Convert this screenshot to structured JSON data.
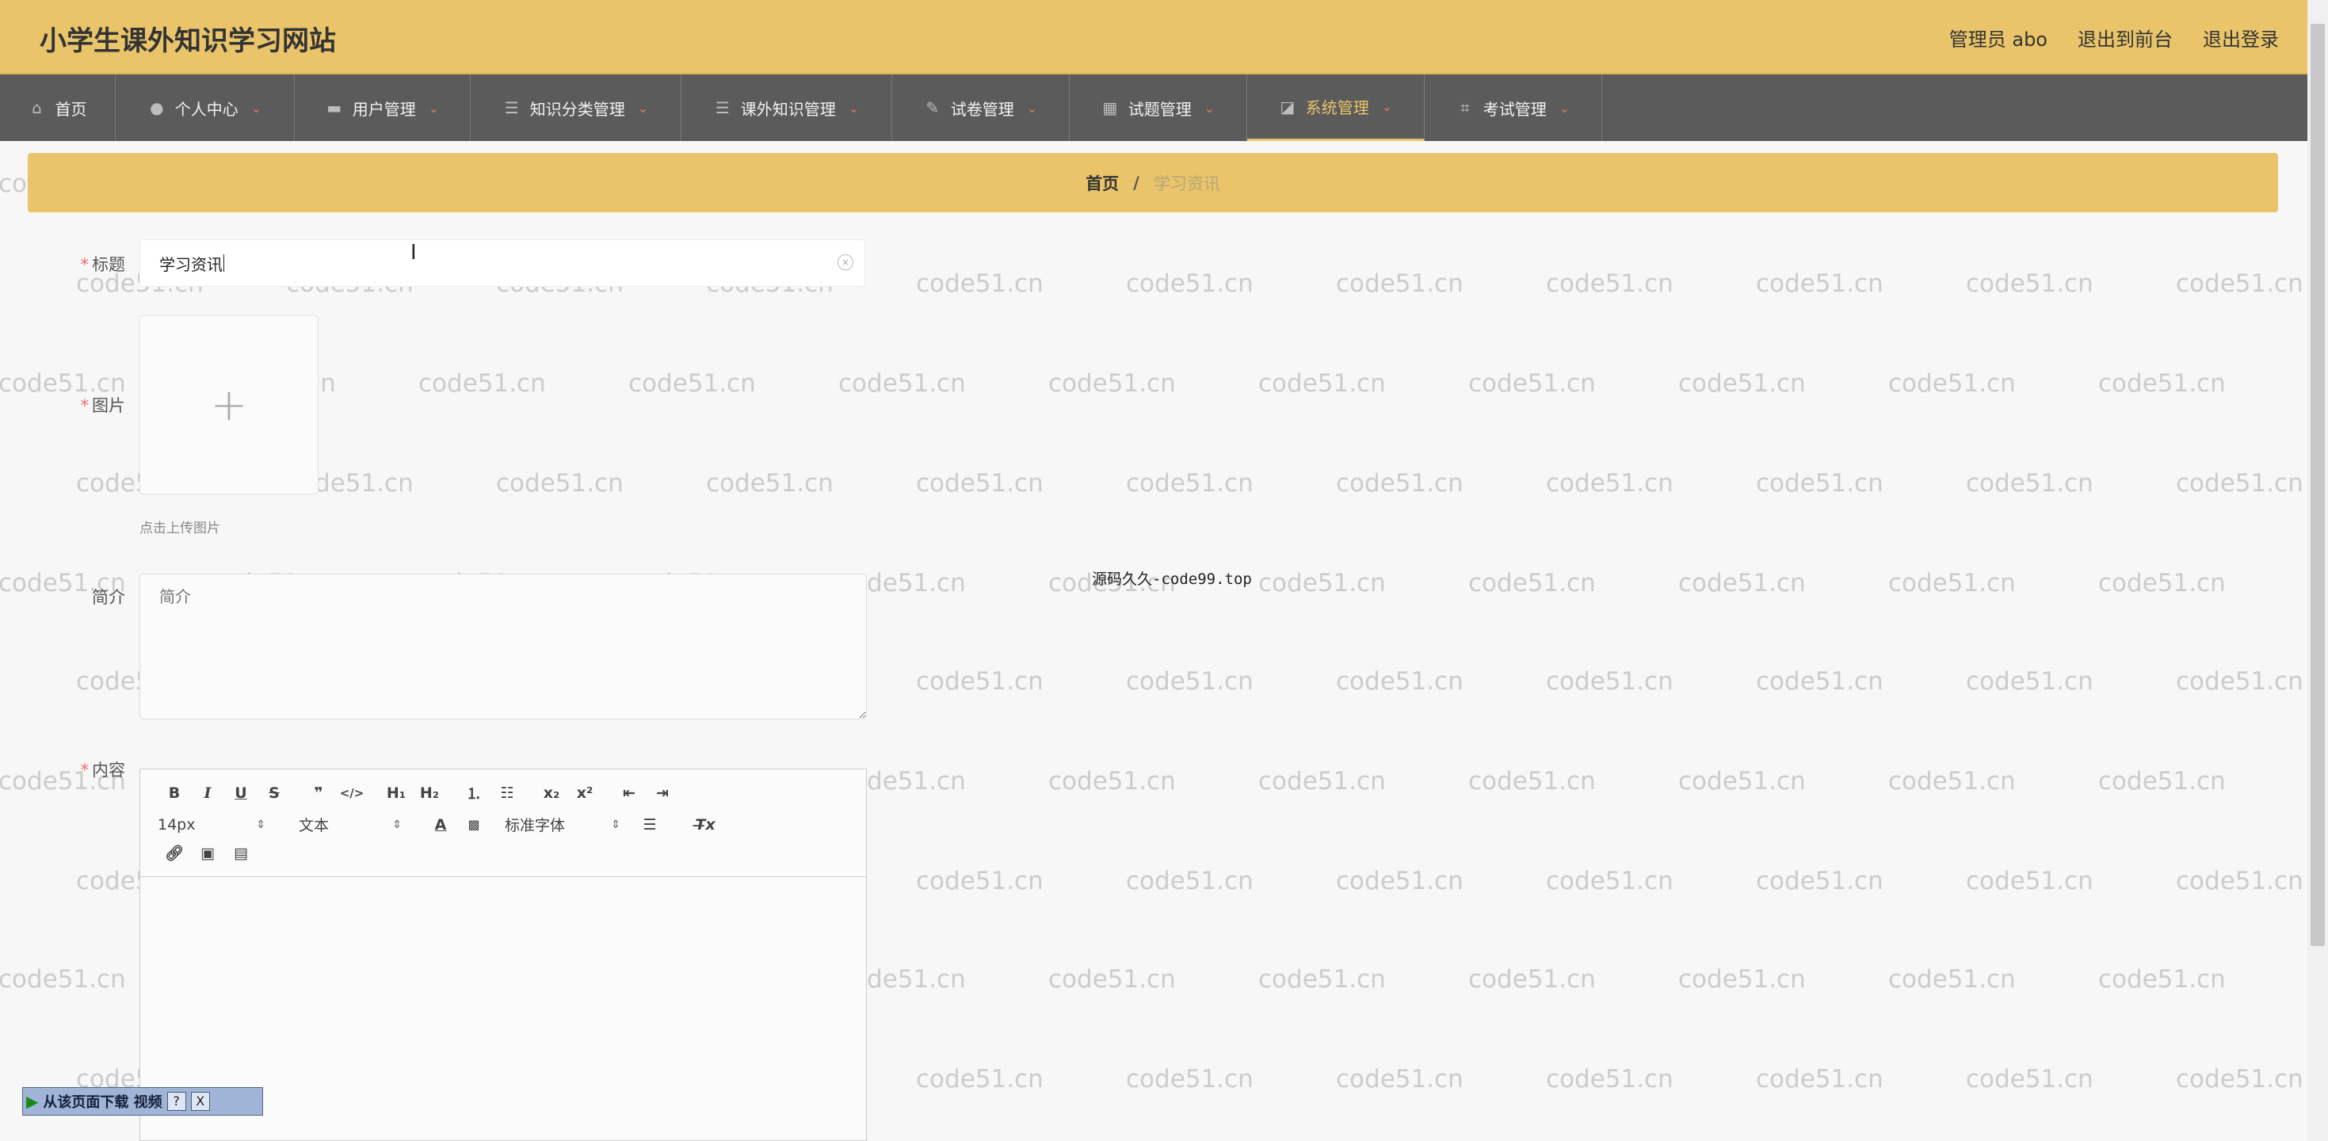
{
  "header": {
    "site_title": "小学生课外知识学习网站",
    "admin_label": "管理员 abo",
    "goto_front": "退出到前台",
    "logout": "退出登录"
  },
  "nav": {
    "items": [
      {
        "label": "首页",
        "icon": "home-icon",
        "has_caret": false
      },
      {
        "label": "个人中心",
        "icon": "user-icon",
        "has_caret": true
      },
      {
        "label": "用户管理",
        "icon": "monitor-icon",
        "has_caret": true
      },
      {
        "label": "知识分类管理",
        "icon": "list-icon",
        "has_caret": true
      },
      {
        "label": "课外知识管理",
        "icon": "list-icon",
        "has_caret": true
      },
      {
        "label": "试卷管理",
        "icon": "edit-icon",
        "has_caret": true
      },
      {
        "label": "试题管理",
        "icon": "grid-icon",
        "has_caret": true
      },
      {
        "label": "系统管理",
        "icon": "chart-icon",
        "has_caret": true,
        "active": true
      },
      {
        "label": "考试管理",
        "icon": "crop-icon",
        "has_caret": true
      }
    ]
  },
  "breadcrumb": {
    "home": "首页",
    "separator": "/",
    "current": "学习资讯"
  },
  "form": {
    "title_label": "标题",
    "title_value": "学习资讯",
    "image_label": "图片",
    "upload_tip": "点击上传图片",
    "intro_label": "简介",
    "intro_placeholder": "简介",
    "content_label": "内容",
    "required_mark": "*"
  },
  "editor": {
    "font_size": "14px",
    "block_type": "文本",
    "font_family": "标准字体"
  },
  "watermark": {
    "text": "code51.cn",
    "center_note": "源码久久-code99.top"
  },
  "download_bar": {
    "label": "从该页面下载 视频",
    "help": "?",
    "close": "X"
  }
}
